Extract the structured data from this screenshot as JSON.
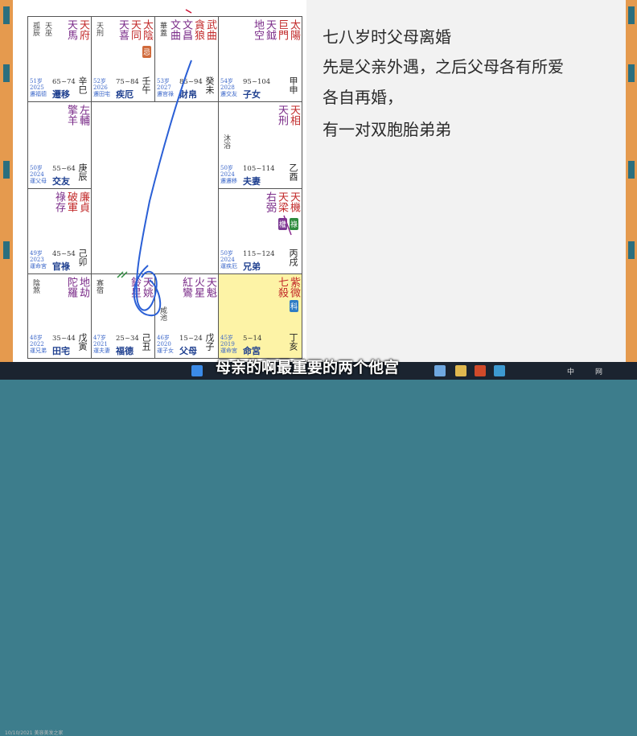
{
  "notes": {
    "line1": "七八岁时父母离婚",
    "line2": "先是父亲外遇，之后父母各有所爱",
    "line3": "各自再婚，",
    "line4": "有一对双胞胎弟弟"
  },
  "subtitle": "母亲的啊最重要的两个他宫",
  "taskbar": {
    "app_label": "10/10/2021 美容美发之家",
    "tray_lang": "中",
    "tray_net": "网"
  },
  "palaces": [
    {
      "id": "si",
      "stars": [
        {
          "t": "天府",
          "c": "red"
        },
        {
          "t": "天馬",
          "c": "purple"
        }
      ],
      "minor": [
        "孤辰",
        "天巫"
      ],
      "info": [
        "51岁",
        "2025",
        "遷福德"
      ],
      "range": "65~74",
      "palace": "遷移",
      "gz": "辛巳"
    },
    {
      "id": "wu",
      "stars": [
        {
          "t": "太陰",
          "c": "red"
        },
        {
          "t": "天同",
          "c": "red"
        },
        {
          "t": "天喜",
          "c": "purple"
        }
      ],
      "minor": [
        "天刑"
      ],
      "badge": {
        "t": "忌",
        "c": "red"
      },
      "info": [
        "52岁",
        "2026",
        "遷田宅"
      ],
      "range": "75~84",
      "palace": "疾厄",
      "gz": "壬午"
    },
    {
      "id": "wei",
      "stars": [
        {
          "t": "武曲",
          "c": "red"
        },
        {
          "t": "貪狼",
          "c": "red"
        },
        {
          "t": "文昌",
          "c": "purple"
        },
        {
          "t": "文曲",
          "c": "purple"
        }
      ],
      "minor": [
        "華蓋"
      ],
      "info": [
        "53岁",
        "2027",
        "遷官祿"
      ],
      "range": "85~94",
      "palace": "財帛",
      "gz": "癸未"
    },
    {
      "id": "shen",
      "stars": [
        {
          "t": "太陽",
          "c": "red"
        },
        {
          "t": "巨門",
          "c": "red"
        },
        {
          "t": "天鉞",
          "c": "purple"
        },
        {
          "t": "地空",
          "c": "purple"
        }
      ],
      "minor": [],
      "info": [
        "54岁",
        "2028",
        "遷交友"
      ],
      "range": "95~104",
      "palace": "子女",
      "gz": "甲申"
    },
    {
      "id": "you",
      "stars": [
        {
          "t": "天相",
          "c": "red"
        },
        {
          "t": "天刑",
          "c": "purple"
        }
      ],
      "minor": [
        "沐浴"
      ],
      "info": [
        "50岁",
        "2024",
        "遷遷移"
      ],
      "range": "105~114",
      "palace": "夫妻",
      "gz": "乙酉"
    },
    {
      "id": "xu",
      "stars": [
        {
          "t": "天機",
          "c": "red"
        },
        {
          "t": "天梁",
          "c": "red"
        },
        {
          "t": "右弼",
          "c": "purple"
        }
      ],
      "minor": [],
      "badges": [
        {
          "t": "祿",
          "c": "green"
        },
        {
          "t": "權",
          "c": "purple"
        }
      ],
      "info": [
        "50岁",
        "2024",
        "運疾厄"
      ],
      "range": "115~124",
      "palace": "兄弟",
      "gz": "丙戌"
    },
    {
      "id": "hai",
      "stars": [
        {
          "t": "紫微",
          "c": "red"
        },
        {
          "t": "七殺",
          "c": "red"
        }
      ],
      "minor": [],
      "badge": {
        "t": "科",
        "c": "blue"
      },
      "info": [
        "45岁",
        "2019",
        "運命宮"
      ],
      "range": "5~14",
      "palace": "命宮",
      "gz": "丁亥"
    },
    {
      "id": "zi",
      "stars": [
        {
          "t": "天魁",
          "c": "purple"
        },
        {
          "t": "火星",
          "c": "purple"
        },
        {
          "t": "紅鸞",
          "c": "purple"
        }
      ],
      "minor": [
        "咸池"
      ],
      "info": [
        "46岁",
        "2020",
        "運子女"
      ],
      "range": "15~24",
      "palace": "父母",
      "gz": "戊子"
    },
    {
      "id": "chou",
      "stars": [
        {
          "t": "天姚",
          "c": "purple"
        },
        {
          "t": "鈴星",
          "c": "purple"
        }
      ],
      "minor": [
        "寡宿"
      ],
      "info": [
        "47岁",
        "2021",
        "運夫妻"
      ],
      "range": "25~34",
      "palace": "福德",
      "gz": "己丑"
    },
    {
      "id": "yin",
      "stars": [
        {
          "t": "地劫",
          "c": "purple"
        },
        {
          "t": "陀羅",
          "c": "purple"
        }
      ],
      "minor": [
        "陰煞"
      ],
      "info": [
        "48岁",
        "2022",
        "運兄弟"
      ],
      "range": "35~44",
      "palace": "田宅",
      "gz": "戊寅"
    },
    {
      "id": "mao",
      "stars": [
        {
          "t": "廉貞",
          "c": "red"
        },
        {
          "t": "破軍",
          "c": "red"
        },
        {
          "t": "祿存",
          "c": "purple"
        }
      ],
      "minor": [],
      "info": [
        "49岁",
        "2023",
        "運命宮"
      ],
      "range": "45~54",
      "palace": "官祿",
      "gz": "己卯"
    },
    {
      "id": "chen",
      "stars": [
        {
          "t": "左輔",
          "c": "purple"
        },
        {
          "t": "擎羊",
          "c": "purple"
        }
      ],
      "minor": [],
      "info": [
        "50岁",
        "2024",
        "運父母"
      ],
      "range": "55~64",
      "palace": "交友",
      "gz": "庚辰"
    }
  ]
}
